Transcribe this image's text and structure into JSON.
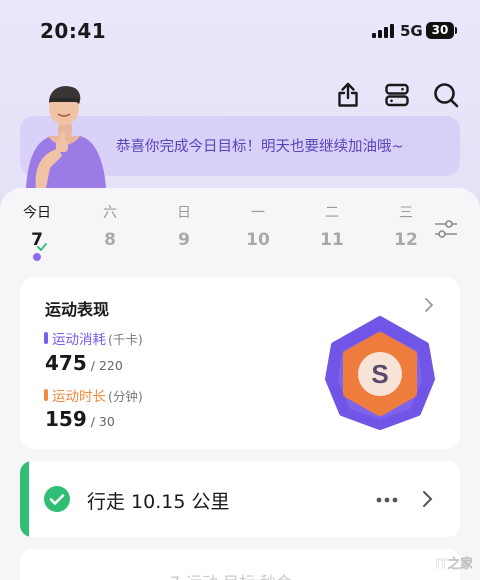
{
  "status_bar": {
    "time": "20:41",
    "network": "5G",
    "battery": "30"
  },
  "header": {
    "icons": [
      "share-icon",
      "toggle-icon",
      "search-icon"
    ]
  },
  "banner": {
    "message": "恭喜你完成今日目标！明天也要继续加油哦~"
  },
  "week": {
    "days": [
      {
        "name": "今日",
        "num": "7",
        "active": true,
        "completed": true
      },
      {
        "name": "六",
        "num": "8",
        "active": false
      },
      {
        "name": "日",
        "num": "9",
        "active": false
      },
      {
        "name": "一",
        "num": "10",
        "active": false
      },
      {
        "name": "二",
        "num": "11",
        "active": false
      },
      {
        "name": "三",
        "num": "12",
        "active": false
      }
    ]
  },
  "performance": {
    "title": "运动表现",
    "calories": {
      "label": "运动消耗",
      "unit": "(千卡)",
      "value": "475",
      "goal": "/ 220",
      "color": "#7b5cf0"
    },
    "duration": {
      "label": "运动时长",
      "unit": "(分钟)",
      "value": "159",
      "goal": "/ 30",
      "color": "#f08a3c"
    },
    "badge": {
      "letter": "S",
      "outer_color": "#7155e6",
      "inner_color": "#ee7d3e"
    }
  },
  "walk": {
    "label": "行走 10.15 公里",
    "accent": "#2fbe74"
  },
  "next_card": {
    "text": "7-运动 目标 秒会"
  },
  "watermark": {
    "text": "IT之家"
  }
}
